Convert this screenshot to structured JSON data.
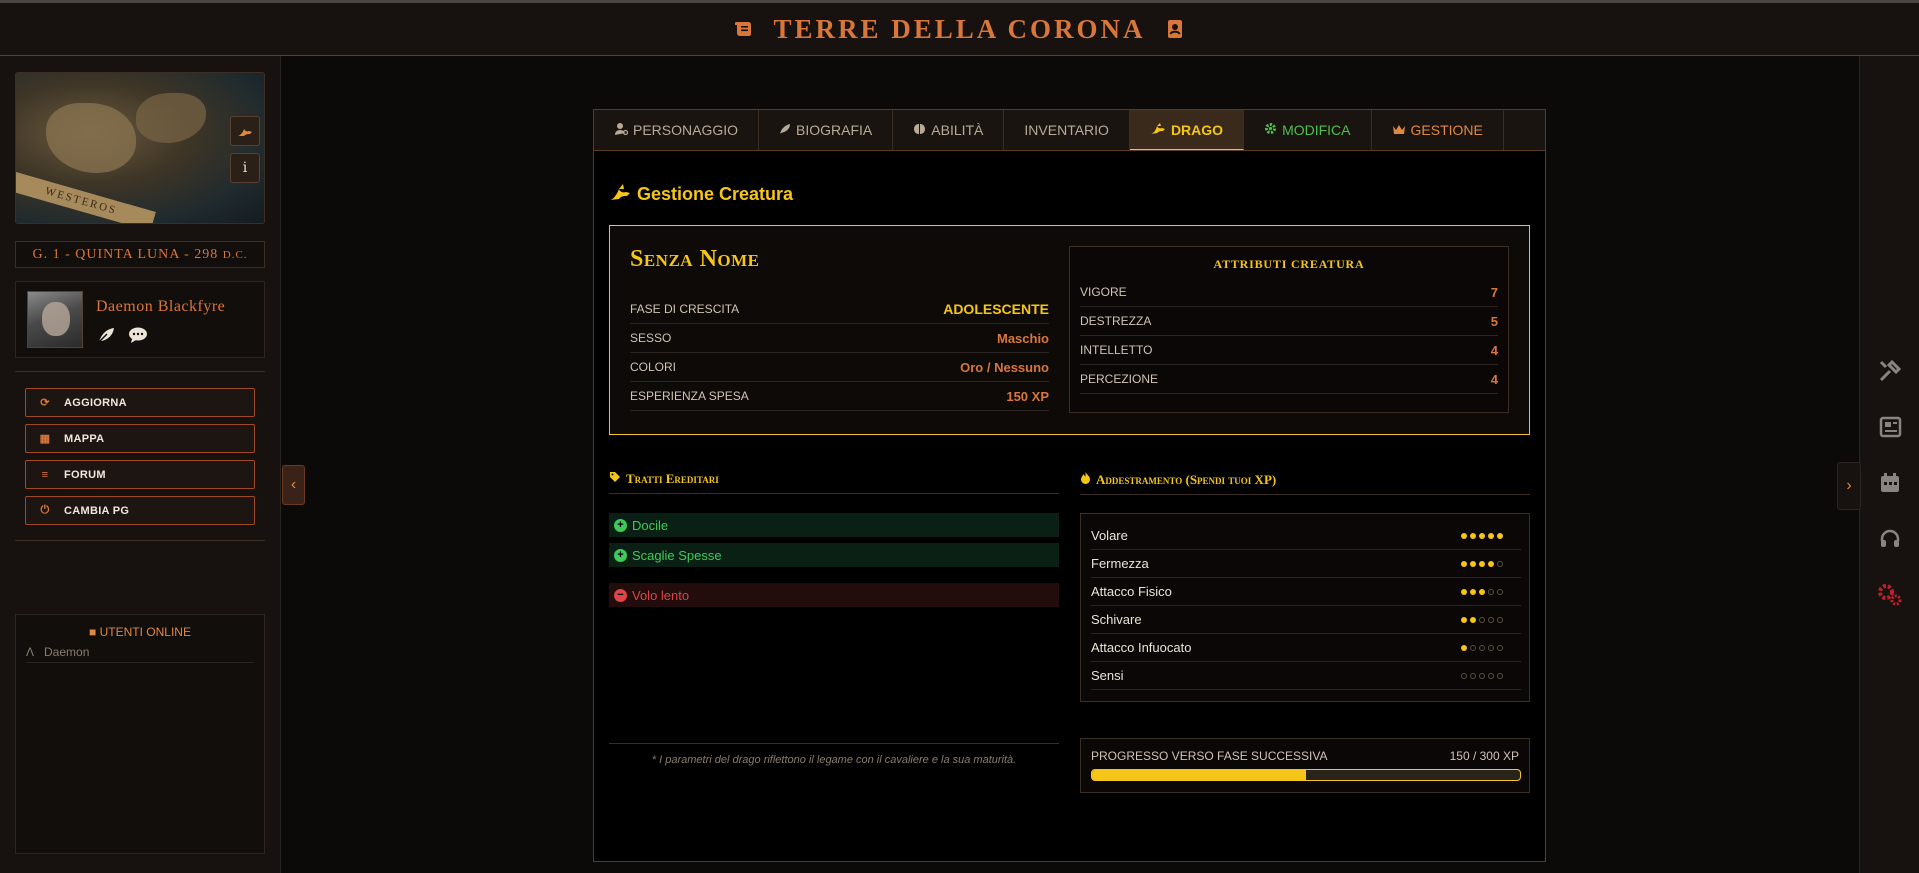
{
  "header": {
    "title": "TERRE DELLA CORONA"
  },
  "sidebar": {
    "map_label": "WESTEROS",
    "date": "G. 1 - QUINTA LUNA - 298",
    "date_suffix": "D.C.",
    "user": {
      "name": "Daemon Blackfyre"
    },
    "nav": [
      {
        "label": "AGGIORNA",
        "icon": "refresh-icon"
      },
      {
        "label": "MAPPA",
        "icon": "map-icon"
      },
      {
        "label": "FORUM",
        "icon": "scroll-icon"
      },
      {
        "label": "CAMBIA PG",
        "icon": "power-icon"
      }
    ],
    "online": {
      "title": "UTENTI ONLINE",
      "users": [
        "Daemon"
      ]
    }
  },
  "tabs": [
    {
      "label": "PERSONAGGIO",
      "icon": "user-icon",
      "state": "normal"
    },
    {
      "label": "BIOGRAFIA",
      "icon": "feather-icon",
      "state": "normal"
    },
    {
      "label": "ABILITÀ",
      "icon": "skills-icon",
      "state": "normal"
    },
    {
      "label": "INVENTARIO",
      "icon": "",
      "state": "normal"
    },
    {
      "label": "DRAGO",
      "icon": "dragon-icon",
      "state": "active"
    },
    {
      "label": "MODIFICA",
      "icon": "gear-icon",
      "state": "green"
    },
    {
      "label": "GESTIONE",
      "icon": "crown-icon",
      "state": "orange"
    }
  ],
  "main": {
    "heading": "Gestione Creatura",
    "creature": {
      "name": "Senza Nome",
      "stats": [
        {
          "label": "FASE DI CRESCITA",
          "value": "ADOLESCENTE"
        },
        {
          "label": "SESSO",
          "value": "Maschio"
        },
        {
          "label": "COLORI",
          "value": "Oro / Nessuno"
        },
        {
          "label": "ESPERIENZA SPESA",
          "value": "150 XP"
        }
      ],
      "attributes_title": "ATTRIBUTI CREATURA",
      "attributes": [
        {
          "label": "VIGORE",
          "value": "7"
        },
        {
          "label": "DESTREZZA",
          "value": "5"
        },
        {
          "label": "INTELLETTO",
          "value": "4"
        },
        {
          "label": "PERCEZIONE",
          "value": "4"
        }
      ]
    },
    "traits_title": "Tratti Ereditari",
    "traits_good": [
      "Docile",
      "Scaglie Spesse"
    ],
    "traits_bad": [
      "Volo lento"
    ],
    "note": "* I parametri del drago riflettono il legame con il cavaliere e la sua maturità.",
    "training_title": "Addestramento (Spendi tuoi XP)",
    "skills": [
      {
        "name": "Volare",
        "level": 5
      },
      {
        "name": "Fermezza",
        "level": 4
      },
      {
        "name": "Attacco Fisico",
        "level": 3
      },
      {
        "name": "Schivare",
        "level": 2
      },
      {
        "name": "Attacco Infuocato",
        "level": 1
      },
      {
        "name": "Sensi",
        "level": 0
      }
    ],
    "progress": {
      "label": "PROGRESSO VERSO FASE SUCCESSIVA",
      "value_text": "150 / 300 XP",
      "current": 150,
      "max": 300
    }
  },
  "colors": {
    "accent": "#f5c518",
    "brand": "#d9763a",
    "good": "#3ecb5a",
    "bad": "#e04444"
  }
}
